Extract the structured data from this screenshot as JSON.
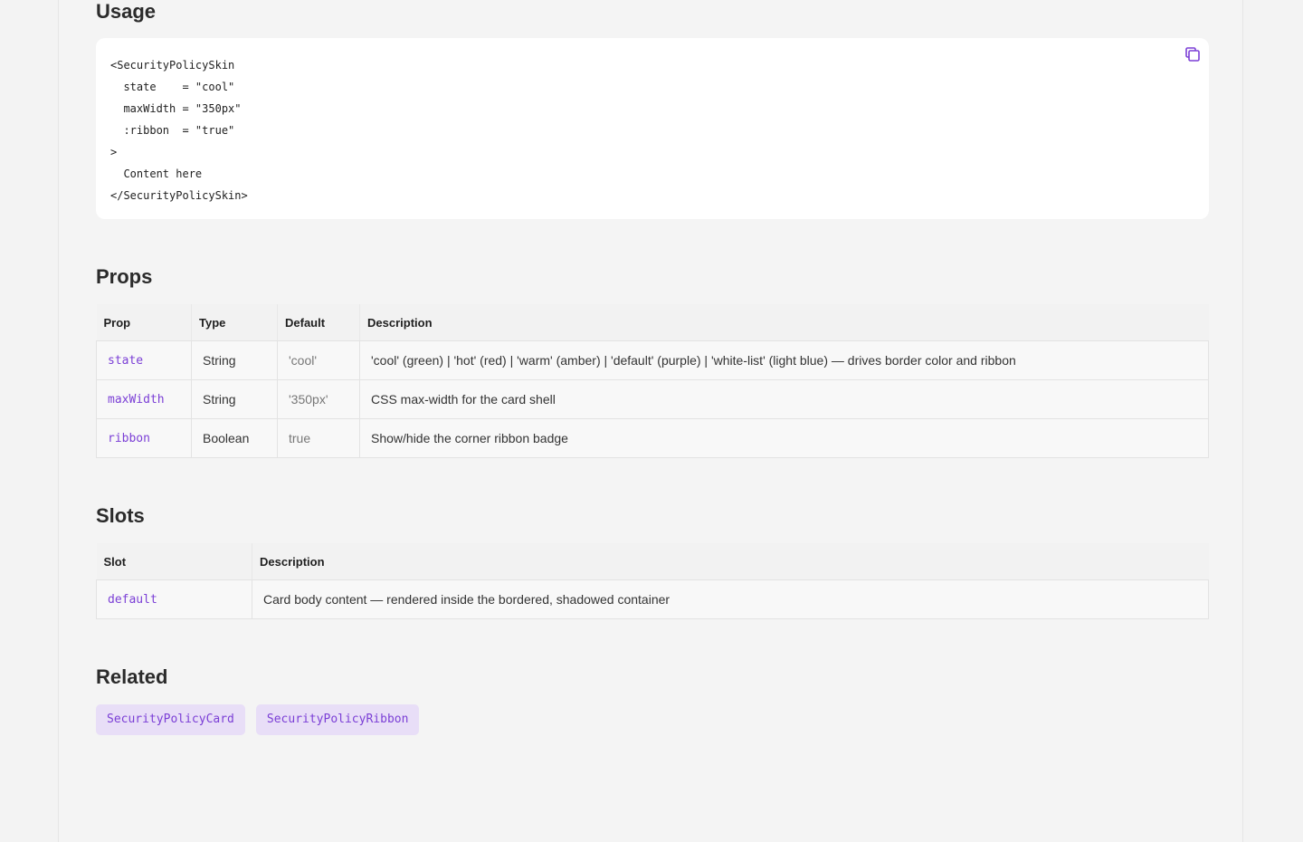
{
  "usage": {
    "heading": "Usage",
    "code_lines": [
      "<SecurityPolicySkin",
      "  state    = \"cool\"",
      "  maxWidth = \"350px\"",
      "  :ribbon  = \"true\"",
      ">",
      "  Content here",
      "</SecurityPolicySkin>"
    ],
    "copy_icon": "copy-icon"
  },
  "props": {
    "heading": "Props",
    "columns": [
      "Prop",
      "Type",
      "Default",
      "Description"
    ],
    "rows": [
      {
        "prop": "state",
        "type": "String",
        "default": "'cool'",
        "description": "'cool' (green) | 'hot' (red) | 'warm' (amber) | 'default' (purple) | 'white-list' (light blue) — drives border color and ribbon"
      },
      {
        "prop": "maxWidth",
        "type": "String",
        "default": "'350px'",
        "description": "CSS max-width for the card shell"
      },
      {
        "prop": "ribbon",
        "type": "Boolean",
        "default": "true",
        "description": "Show/hide the corner ribbon badge"
      }
    ]
  },
  "slots": {
    "heading": "Slots",
    "columns": [
      "Slot",
      "Description"
    ],
    "rows": [
      {
        "slot": "default",
        "description": "Card body content — rendered inside the bordered, shadowed container"
      }
    ]
  },
  "related": {
    "heading": "Related",
    "items": [
      "SecurityPolicyCard",
      "SecurityPolicyRibbon"
    ]
  },
  "colors": {
    "accent": "#7b3fd6",
    "chip_bg": "#e8def7",
    "page_bg": "#f4f4f4"
  }
}
